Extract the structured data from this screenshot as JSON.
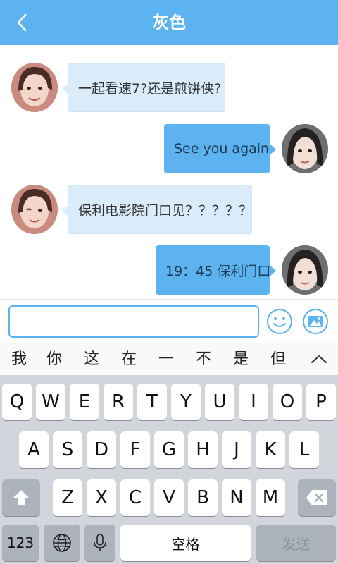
{
  "header": {
    "title": "灰色",
    "back_icon": "chevron-left-icon",
    "bg": "#5cb3ef"
  },
  "messages": [
    {
      "side": "left",
      "text": "一起看速7?还是煎饼侠?"
    },
    {
      "side": "right",
      "text": "See you again"
    },
    {
      "side": "left",
      "text": "保利电影院门口见？？？？？"
    },
    {
      "side": "right",
      "text": "19：45 保利门口"
    }
  ],
  "input": {
    "value": "",
    "placeholder": ""
  },
  "input_icons": {
    "emoji": "smiley-icon",
    "image": "image-icon"
  },
  "candidates": [
    "我",
    "你",
    "这",
    "在",
    "一",
    "不",
    "是",
    "但"
  ],
  "keyboard": {
    "row1": [
      "Q",
      "W",
      "E",
      "R",
      "T",
      "Y",
      "U",
      "I",
      "O",
      "P"
    ],
    "row2": [
      "A",
      "S",
      "D",
      "F",
      "G",
      "H",
      "J",
      "K",
      "L"
    ],
    "row3": [
      "Z",
      "X",
      "C",
      "V",
      "B",
      "N",
      "M"
    ],
    "numbers_label": "123",
    "space_label": "空格",
    "send_label": "发送"
  }
}
